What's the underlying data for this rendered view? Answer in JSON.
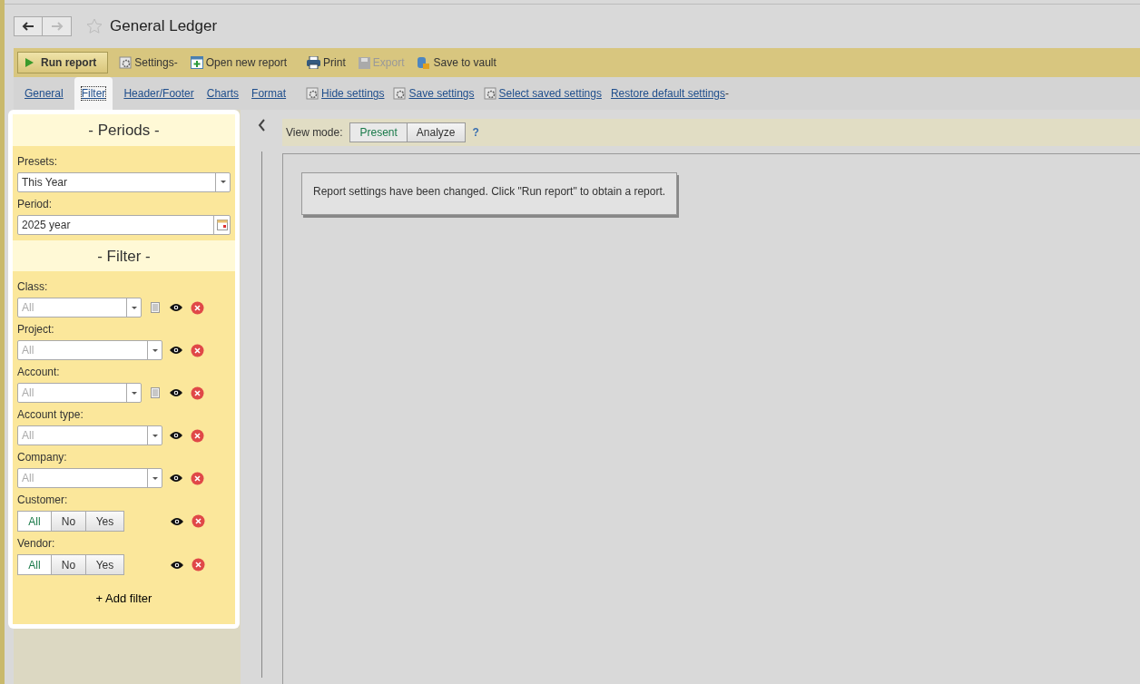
{
  "window": {
    "title": "General Ledger",
    "favorite": false
  },
  "toolbar": [
    {
      "label": "Run report",
      "kind": "primary",
      "disabled": false
    },
    {
      "label": "Settings-",
      "kind": "tool",
      "disabled": false
    },
    {
      "label": "Open new report",
      "kind": "tool",
      "disabled": false
    },
    {
      "label": "Print",
      "kind": "tool",
      "disabled": false
    },
    {
      "label": "Export",
      "kind": "tool",
      "disabled": true
    },
    {
      "label": "Save to vault",
      "kind": "tool",
      "disabled": false
    }
  ],
  "settings_tabs": [
    {
      "label": "General",
      "selected": false
    },
    {
      "label": "Filter",
      "selected": true
    },
    {
      "label": "Header/Footer",
      "selected": false
    },
    {
      "label": "Charts",
      "selected": false
    },
    {
      "label": "Format",
      "selected": false
    }
  ],
  "settings_links": [
    {
      "label": "Hide settings"
    },
    {
      "label": "Save settings"
    },
    {
      "label": "Select saved settings"
    },
    {
      "label": "Restore default settings",
      "menu_mark": "-"
    }
  ],
  "periods": {
    "title": "- Periods -",
    "presets_label": "Presets:",
    "presets_value": "This Year",
    "period_label": "Period:",
    "period_value": "2025 year"
  },
  "filter": {
    "title": "- Filter -",
    "items": [
      {
        "label": "Class:",
        "kind": "select",
        "placeholder": "All",
        "list_icon": true
      },
      {
        "label": "Project:",
        "kind": "select",
        "placeholder": "All",
        "list_icon": false
      },
      {
        "label": "Account:",
        "kind": "select",
        "placeholder": "All",
        "list_icon": true
      },
      {
        "label": "Account type:",
        "kind": "select",
        "placeholder": "All",
        "list_icon": false
      },
      {
        "label": "Company:",
        "kind": "select",
        "placeholder": "All",
        "list_icon": false
      },
      {
        "label": "Customer:",
        "kind": "toggle",
        "options": [
          {
            "label": "All",
            "selected": true
          },
          {
            "label": "No",
            "selected": false
          },
          {
            "label": "Yes",
            "selected": false
          }
        ]
      },
      {
        "label": "Vendor:",
        "kind": "toggle",
        "options": [
          {
            "label": "All",
            "selected": true
          },
          {
            "label": "No",
            "selected": false
          },
          {
            "label": "Yes",
            "selected": false
          }
        ]
      }
    ],
    "add_label": "+ Add filter"
  },
  "view_mode": {
    "label": "View mode:",
    "options": [
      {
        "label": "Present",
        "selected": true
      },
      {
        "label": "Analyze",
        "selected": false
      }
    ],
    "help": "?"
  },
  "message": "Report settings have been changed. Click \"Run report\" to obtain a report."
}
